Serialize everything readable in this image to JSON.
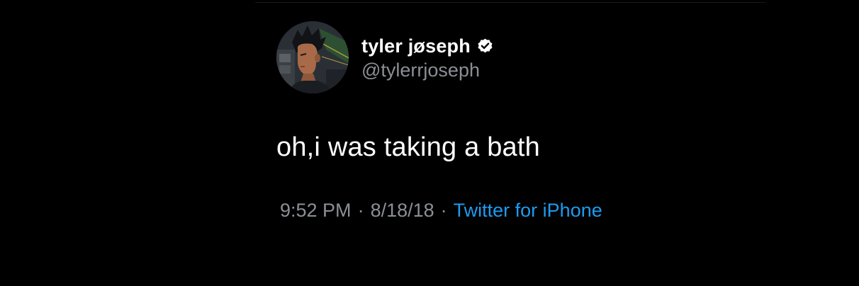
{
  "tweet": {
    "author": {
      "display_name": "tyler jøseph",
      "handle": "@tylerrjoseph",
      "verified": true,
      "avatar_icon": "illustrated-profile-avatar"
    },
    "text": "oh,i was taking a bath",
    "meta": {
      "time": "9:52 PM",
      "separator": "·",
      "date": "8/18/18",
      "source": "Twitter for iPhone"
    }
  },
  "colors": {
    "background": "#000000",
    "primary_text": "#ffffff",
    "secondary_text": "#8b8f95",
    "link": "#1d9bf0"
  }
}
